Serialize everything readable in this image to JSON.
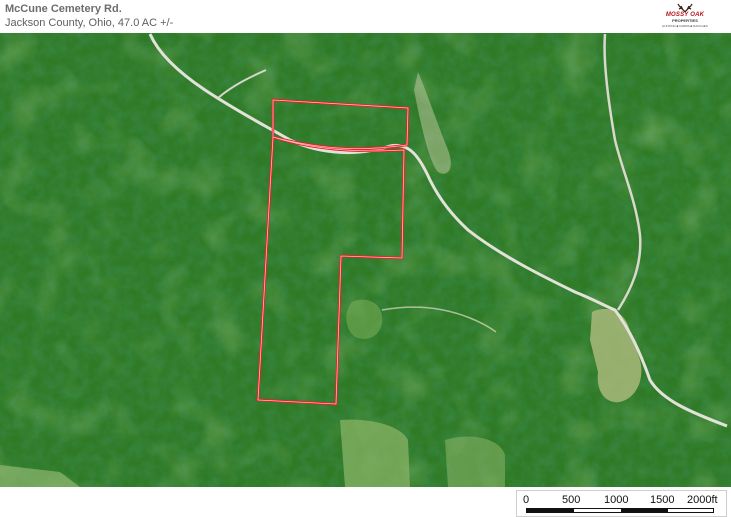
{
  "header": {
    "title": "McCune Cemetery Rd.",
    "subtitle": "Jackson County, Ohio, 47.0  AC +/-"
  },
  "logo": {
    "brand": "MOSSY OAK",
    "sub": "PROPERTIES",
    "tag": "HUNTING ■ FARMS ■ RANCHES",
    "icon": "antler-emblem-icon"
  },
  "map": {
    "type": "satellite-imagery",
    "boundary_color": "#ee1c25",
    "road_color": "#e2e2d8"
  },
  "scale": {
    "labels": [
      "0",
      "500",
      "1000",
      "1500",
      "2000ft"
    ],
    "colors": [
      "#111111",
      "#ffffff"
    ]
  }
}
